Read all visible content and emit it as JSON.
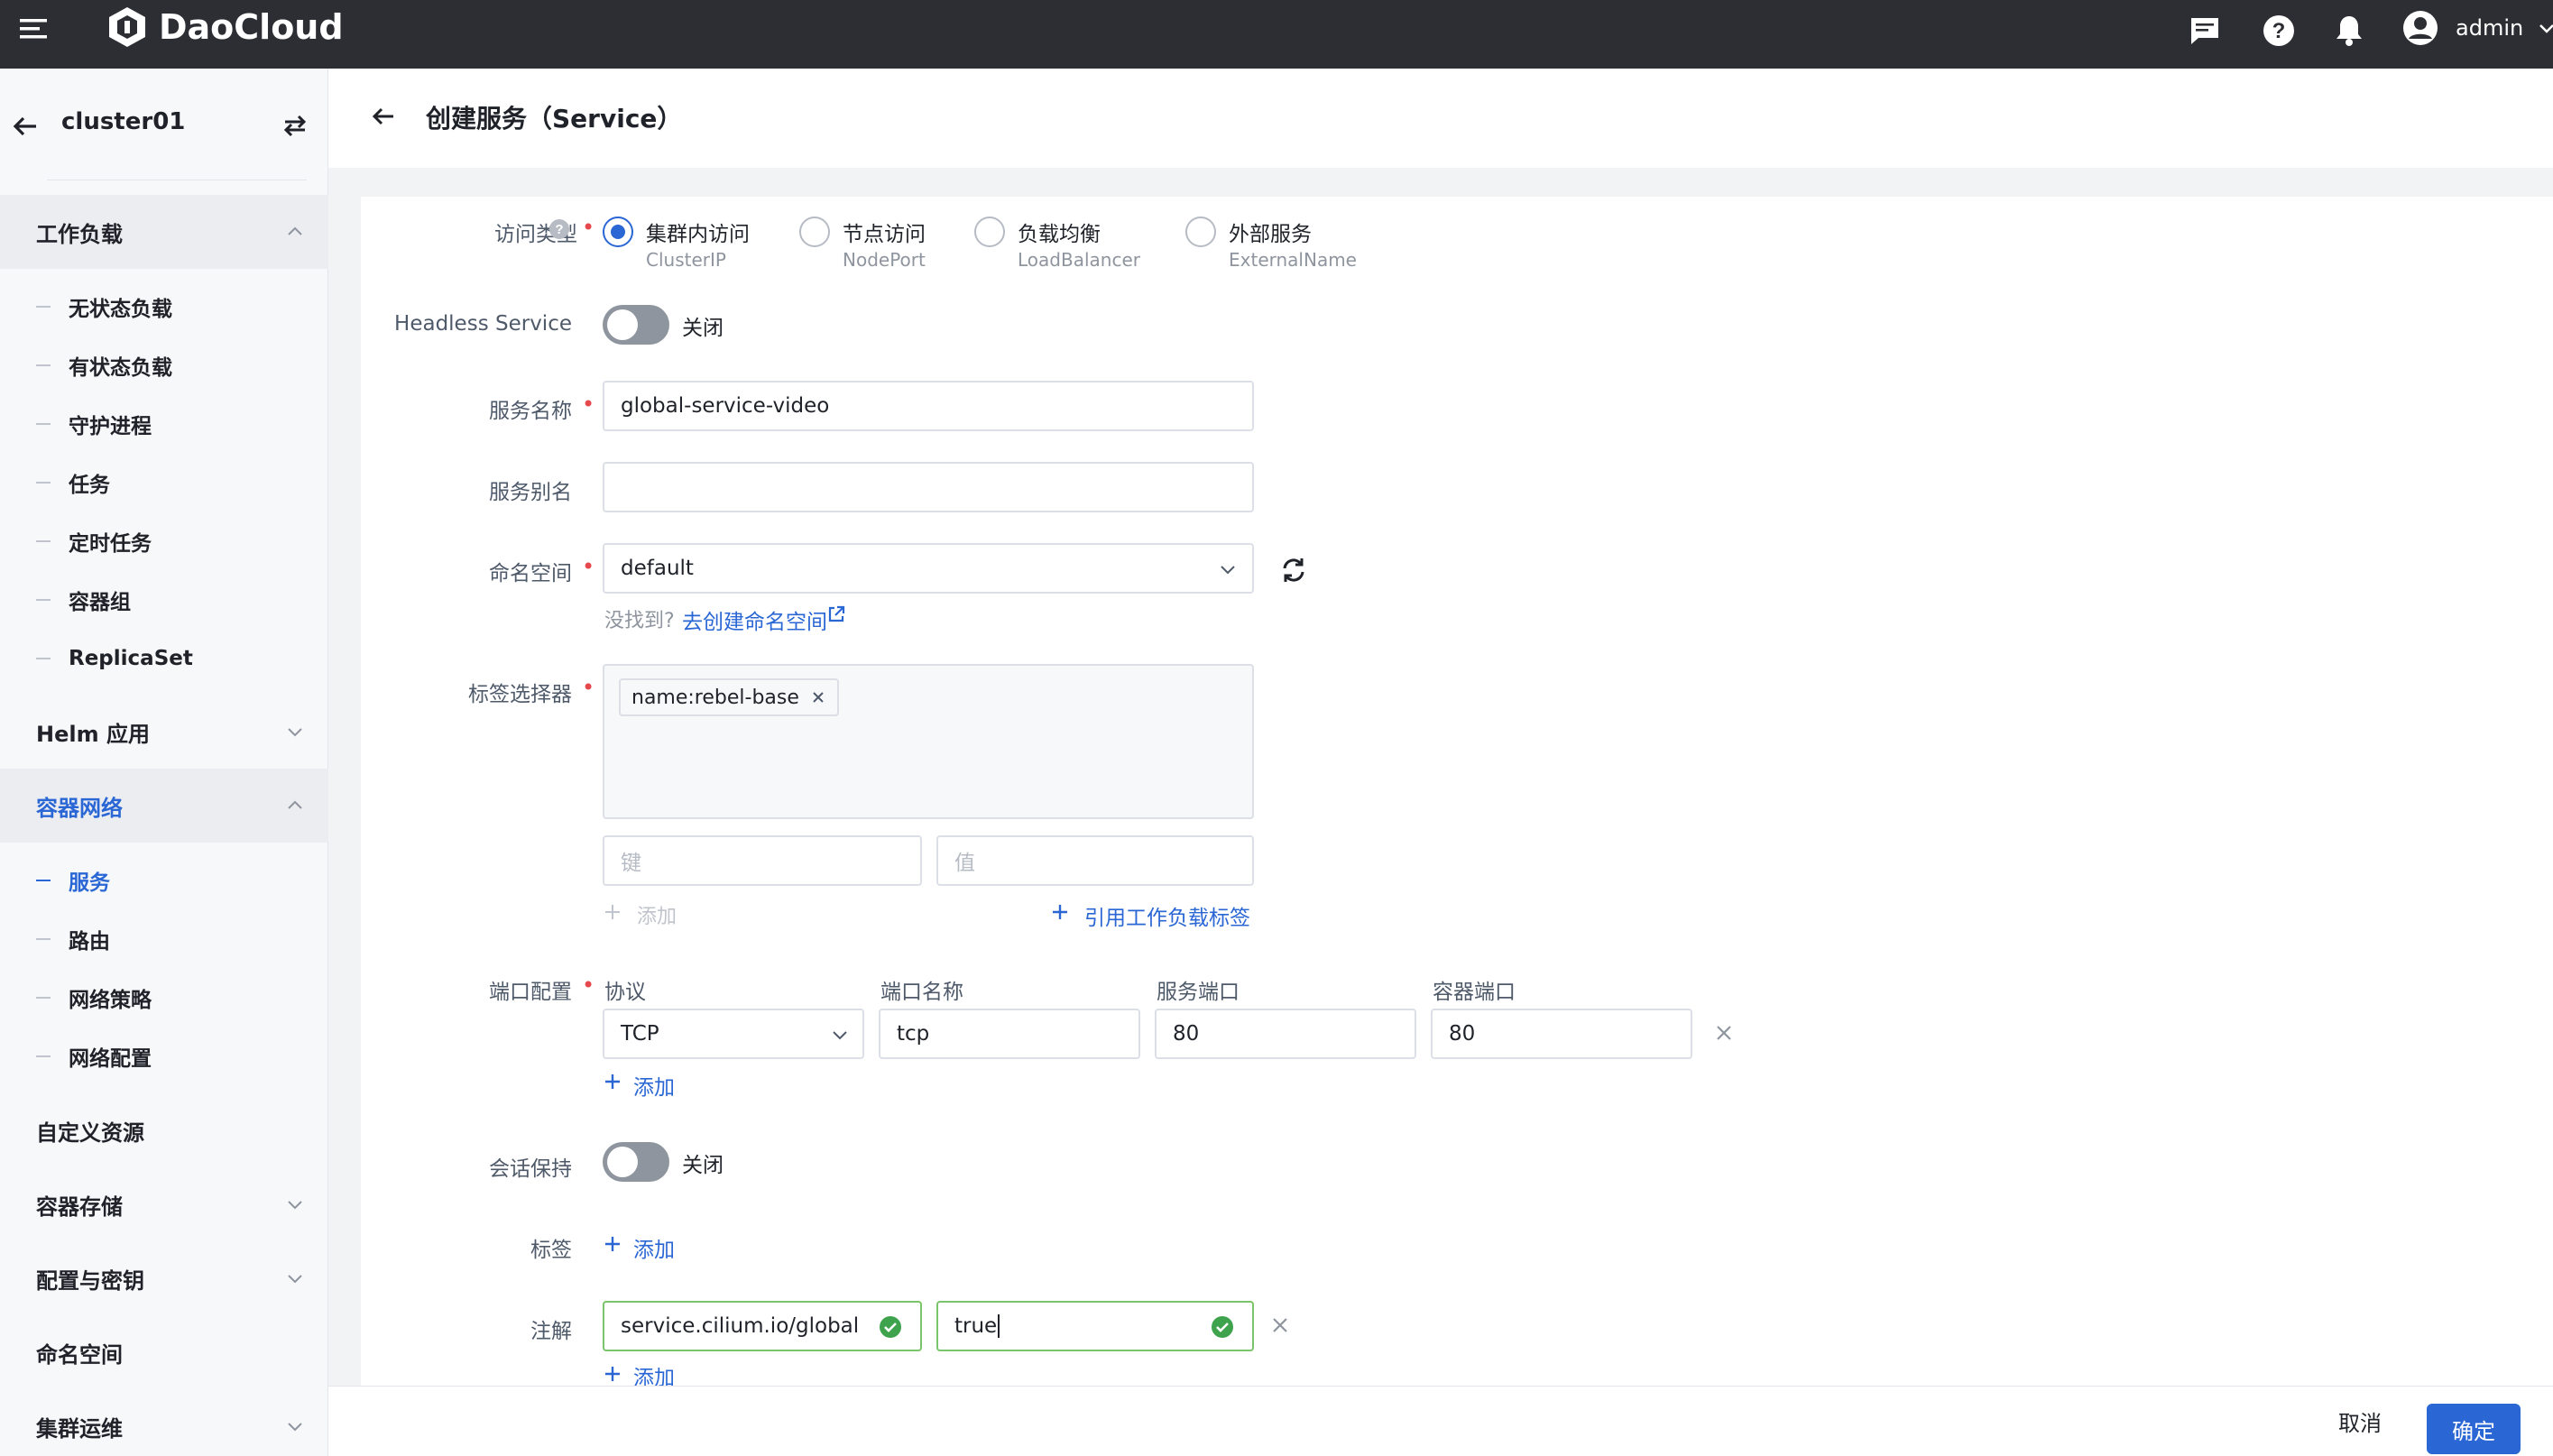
{
  "topbar": {
    "brand": "DaoCloud",
    "user": "admin"
  },
  "sidebar": {
    "cluster": "cluster01",
    "groups": [
      {
        "label": "工作负载"
      },
      {
        "label": "Helm 应用"
      },
      {
        "label": "容器网络"
      },
      {
        "label": "自定义资源"
      },
      {
        "label": "容器存储"
      },
      {
        "label": "配置与密钥"
      },
      {
        "label": "命名空间"
      },
      {
        "label": "集群运维"
      }
    ],
    "workload_items": [
      "无状态负载",
      "有状态负载",
      "守护进程",
      "任务",
      "定时任务",
      "容器组",
      "ReplicaSet"
    ],
    "network_items": [
      "服务",
      "路由",
      "网络策略",
      "网络配置"
    ]
  },
  "page": {
    "title": "创建服务（Service）"
  },
  "form": {
    "access_type": {
      "label": "访问类型",
      "options": [
        {
          "main": "集群内访问",
          "sub": "ClusterIP",
          "selected": true
        },
        {
          "main": "节点访问",
          "sub": "NodePort",
          "selected": false
        },
        {
          "main": "负载均衡",
          "sub": "LoadBalancer",
          "selected": false
        },
        {
          "main": "外部服务",
          "sub": "ExternalName",
          "selected": false
        }
      ]
    },
    "headless": {
      "label": "Headless Service",
      "state": "关闭"
    },
    "service_name": {
      "label": "服务名称",
      "value": "global-service-video"
    },
    "service_alias": {
      "label": "服务别名",
      "value": ""
    },
    "namespace": {
      "label": "命名空间",
      "value": "default",
      "hint": "没找到?",
      "hint_link": "去创建命名空间"
    },
    "selector": {
      "label": "标签选择器",
      "tags": [
        "name:rebel-base"
      ],
      "key_placeholder": "键",
      "value_placeholder": "值",
      "add_label": "添加",
      "ref_label": "引用工作负载标签"
    },
    "ports": {
      "label": "端口配置",
      "headers": [
        "协议",
        "端口名称",
        "服务端口",
        "容器端口"
      ],
      "rows": [
        {
          "protocol": "TCP",
          "name": "tcp",
          "service_port": "80",
          "container_port": "80"
        }
      ],
      "add_label": "添加"
    },
    "session": {
      "label": "会话保持",
      "state": "关闭"
    },
    "labels": {
      "label": "标签",
      "add_label": "添加"
    },
    "annotations": {
      "label": "注解",
      "rows": [
        {
          "key": "service.cilium.io/global",
          "value": "true"
        }
      ],
      "add_label": "添加"
    }
  },
  "footer": {
    "cancel": "取消",
    "confirm": "确定"
  },
  "colors": {
    "topbar": "#2c2e33",
    "primary": "#2a67d5",
    "required": "#e5484d",
    "success": "#3fa34d"
  }
}
